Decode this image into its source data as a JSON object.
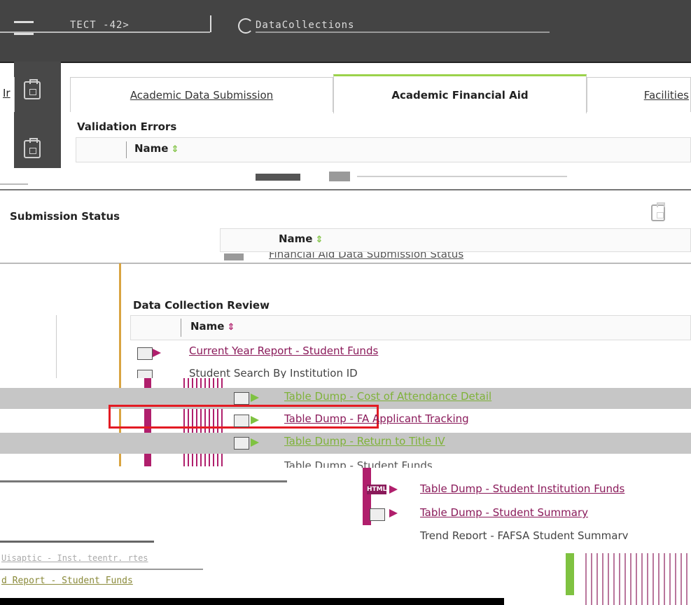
{
  "header": {
    "fragment_left": "TECT -42>",
    "fragment_center": "DataCollections"
  },
  "tabs": [
    {
      "label": "Academic Data Submission",
      "active": false
    },
    {
      "label": "Academic Financial Aid",
      "active": true
    },
    {
      "label": "Facilities",
      "active": false
    }
  ],
  "tab_cut_label": "Ir",
  "validation": {
    "title": "Validation Errors",
    "name_col": "Name"
  },
  "submission": {
    "title": "Submission Status",
    "name_col": "Name",
    "item": "Financial Aid Data Submission Status"
  },
  "review": {
    "title": "Data Collection Review",
    "name_col": "Name",
    "items": [
      {
        "label": "Current Year Report - Student Funds",
        "style": "pink"
      },
      {
        "label": "Student Search By Institution ID",
        "style": "pink"
      },
      {
        "label": "Table Dump - Cost of Attendance Detail",
        "style": "green"
      },
      {
        "label": "Table Dump - FA Applicant Tracking",
        "style": "pink"
      },
      {
        "label": "Table Dump - Return to Title IV",
        "style": "green"
      },
      {
        "label": "Table Dump - Student Funds",
        "style": "pink"
      },
      {
        "label": "Table Dump - Student Institution Funds",
        "style": "pink"
      },
      {
        "label": "Table Dump - Student Summary",
        "style": "pink"
      },
      {
        "label": "Trend Report - FAFSA Student Summary",
        "style": "pink"
      }
    ]
  },
  "bottom": {
    "line1": "Uisaptic - Inst. teentr. rtes",
    "line2": "d Report - Student Funds"
  },
  "colors": {
    "accent_green": "#7fc241",
    "link_pink": "#8a1a5a",
    "highlight_red": "#e31b23"
  }
}
